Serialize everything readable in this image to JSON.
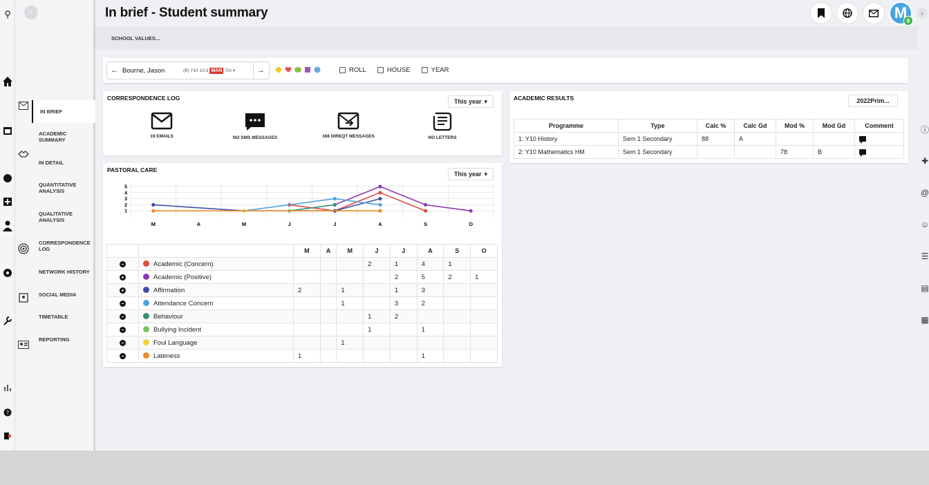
{
  "header": {
    "title": "In brief - Student summary",
    "school_values": "SCHOOL VALUES...",
    "avatar_letter": "M",
    "avatar_badge": "8"
  },
  "nav": {
    "items": [
      {
        "label": "IN BRIEF",
        "active": true
      },
      {
        "label": "ACADEMIC SUMMARY"
      },
      {
        "label": "IN DETAIL"
      },
      {
        "label": "QUANTITATIVE ANALYSIS"
      },
      {
        "label": "QUALITATIVE ANALYSIS"
      },
      {
        "label": "CORRESPONDENCE LOG"
      },
      {
        "label": "NETWORK HISTORY"
      },
      {
        "label": "SOCIAL MEDIA"
      },
      {
        "label": "TIMETABLE"
      },
      {
        "label": "REPORTING"
      }
    ]
  },
  "selector": {
    "student_name": "Bourne, Jason",
    "info": "(B) Y10 10.3",
    "tag": "MAN",
    "tag_suffix": "TAI",
    "swatch_colors": [
      "#f5c518",
      "#e8505b",
      "#8bc34a",
      "#9b59b6",
      "#6fa8dc"
    ],
    "checks": [
      "ROLL",
      "HOUSE",
      "YEAR"
    ]
  },
  "correspondence": {
    "title": "CORRESPONDENCE LOG",
    "period": "This year",
    "items": [
      {
        "label": "19 EMAILS",
        "icon": "email-icon"
      },
      {
        "label": "NO SMS MESSAGES",
        "icon": "sms-icon"
      },
      {
        "label": "168 DIREQT MESSAGES",
        "icon": "direqt-message-icon"
      },
      {
        "label": "NO LETTERS",
        "icon": "letter-icon"
      }
    ]
  },
  "pastoral": {
    "title": "PASTORAL CARE",
    "period": "This year",
    "months": [
      "M",
      "A",
      "M",
      "J",
      "J",
      "A",
      "S",
      "O"
    ],
    "rows": [
      {
        "name": "Academic (Concern)",
        "color": "#e04a3f",
        "toggle": "minus",
        "values": [
          "",
          "",
          "",
          "2",
          "1",
          "4",
          "1",
          ""
        ]
      },
      {
        "name": "Academic (Positive)",
        "color": "#8e3ab5",
        "toggle": "plus",
        "values": [
          "",
          "",
          "",
          "",
          "2",
          "5",
          "2",
          "1"
        ]
      },
      {
        "name": "Affirmation",
        "color": "#3f4ea8",
        "toggle": "plus",
        "values": [
          "2",
          "",
          "1",
          "",
          "1",
          "3",
          "",
          ""
        ]
      },
      {
        "name": "Attendance Concern",
        "color": "#4fa3e0",
        "toggle": "minus",
        "values": [
          "",
          "",
          "1",
          "",
          "3",
          "2",
          "",
          ""
        ]
      },
      {
        "name": "Behaviour",
        "color": "#3a8f7a",
        "toggle": "minus",
        "values": [
          "",
          "",
          "",
          "1",
          "2",
          "",
          "",
          ""
        ]
      },
      {
        "name": "Bullying Incident",
        "color": "#7cc05a",
        "toggle": "minus",
        "values": [
          "",
          "",
          "",
          "1",
          "",
          "1",
          "",
          ""
        ]
      },
      {
        "name": "Foul Language",
        "color": "#f2d43a",
        "toggle": "minus",
        "values": [
          "",
          "",
          "1",
          "",
          "",
          "",
          "",
          ""
        ]
      },
      {
        "name": "Lateness",
        "color": "#ec8a2c",
        "toggle": "minus",
        "values": [
          "1",
          "",
          "",
          "",
          "",
          "1",
          "",
          ""
        ]
      }
    ]
  },
  "chart_data": {
    "type": "line",
    "categories": [
      "M",
      "A",
      "M",
      "J",
      "J",
      "A",
      "S",
      "O"
    ],
    "ylim": [
      0,
      5
    ],
    "yticks": [
      "1",
      "2",
      "3",
      "4",
      "5"
    ],
    "series": [
      {
        "name": "Academic (Concern)",
        "color": "#e04a3f",
        "values": [
          null,
          null,
          null,
          2,
          1,
          4,
          1,
          null
        ]
      },
      {
        "name": "Academic (Positive)",
        "color": "#8e3ab5",
        "values": [
          null,
          null,
          null,
          null,
          2,
          5,
          2,
          1
        ]
      },
      {
        "name": "Affirmation",
        "color": "#3f4ea8",
        "values": [
          2,
          null,
          1,
          null,
          1,
          3,
          null,
          null
        ]
      },
      {
        "name": "Attendance Concern",
        "color": "#4fa3e0",
        "values": [
          null,
          null,
          1,
          null,
          3,
          2,
          null,
          null
        ]
      },
      {
        "name": "Behaviour",
        "color": "#3a8f7a",
        "values": [
          null,
          null,
          null,
          1,
          2,
          null,
          null,
          null
        ]
      },
      {
        "name": "Bullying Incident",
        "color": "#7cc05a",
        "values": [
          null,
          null,
          null,
          1,
          null,
          1,
          null,
          null
        ]
      },
      {
        "name": "Foul Language",
        "color": "#f2d43a",
        "values": [
          null,
          null,
          1,
          null,
          null,
          null,
          null,
          null
        ]
      },
      {
        "name": "Lateness",
        "color": "#ec8a2c",
        "values": [
          1,
          null,
          null,
          null,
          null,
          1,
          null,
          null
        ]
      }
    ]
  },
  "academic": {
    "title": "ACADEMIC RESULTS",
    "year_button": "2022Prim...",
    "columns": [
      "Programme",
      "Type",
      "Calc %",
      "Calc Gd",
      "Mod %",
      "Mod Gd",
      "Comment"
    ],
    "rows": [
      {
        "programme": "1: Y10 History",
        "type": "Sem 1 Secondary",
        "calc_pct": "88",
        "calc_gd": "A",
        "mod_pct": "",
        "mod_gd": ""
      },
      {
        "programme": "2: Y10 Mathematics HM",
        "type": "Sem 1 Secondary",
        "calc_pct": "",
        "calc_gd": "",
        "mod_pct": "78",
        "mod_gd": "B"
      }
    ]
  }
}
